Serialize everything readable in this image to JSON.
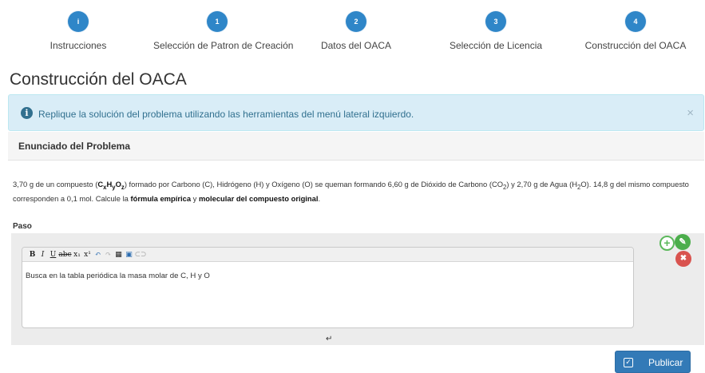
{
  "wizard": {
    "steps": [
      {
        "badge": "i",
        "label": "Instrucciones"
      },
      {
        "badge": "1",
        "label": "Selección de Patron de Creación"
      },
      {
        "badge": "2",
        "label": "Datos del OACA"
      },
      {
        "badge": "3",
        "label": "Selección de Licencia"
      },
      {
        "badge": "4",
        "label": "Construcción del OACA"
      }
    ]
  },
  "page": {
    "title": "Construcción del OACA"
  },
  "alert": {
    "icon": "info-icon",
    "text": "Replique la solución del problema utilizando las herramientas del menú lateral izquierdo.",
    "close": "×"
  },
  "problem": {
    "heading": "Enunciado del Problema",
    "statement": {
      "p1": "3,70 g de un compuesto (",
      "formula_c": "C",
      "sub_x": "x",
      "formula_h": "H",
      "sub_y": "y",
      "formula_o": "O",
      "sub_z": "z",
      "p2": ") formado por Carbono (C), Hidrógeno (H) y Oxígeno (O) se queman formando 6,60 g de Dióxido de Carbono (CO",
      "sub_2a": "2",
      "p3": ") y 2,70 g de Agua (H",
      "sub_2b": "2",
      "p4": "O). 14,8 g del mismo compuesto corresponden a 0,1 mol. Calcule la ",
      "bold1": "fórmula empírica",
      "p5": " y ",
      "bold2": "molecular del compuesto original",
      "p6": "."
    }
  },
  "paso": {
    "label": "Paso",
    "toolbar": [
      {
        "icon": "bold-icon",
        "glyph": "B"
      },
      {
        "icon": "italic-icon",
        "glyph": "I"
      },
      {
        "icon": "underline-icon",
        "glyph": "U"
      },
      {
        "icon": "strikethrough-icon",
        "glyph": "abc"
      },
      {
        "icon": "subscript-icon",
        "glyph": "x₁"
      },
      {
        "icon": "superscript-icon",
        "glyph": "x¹"
      },
      {
        "icon": "undo-icon",
        "glyph": "↶"
      },
      {
        "icon": "redo-icon",
        "glyph": "↷"
      },
      {
        "icon": "table-icon",
        "glyph": "▦"
      },
      {
        "icon": "image-icon",
        "glyph": "▣"
      },
      {
        "icon": "link-icon",
        "glyph": "⊂⊃"
      }
    ],
    "content": "Busca en la tabla periódica la masa molar de C, H y O",
    "actions": {
      "add": "+",
      "edit": "✎",
      "delete": "✖"
    }
  },
  "publish": {
    "label": "Publicar",
    "icon": "check-icon"
  },
  "colors": {
    "primary": "#337ab7",
    "step": "#2f86c8",
    "info_bg": "#d9edf7",
    "success": "#5cb85c",
    "danger": "#d9534f"
  }
}
